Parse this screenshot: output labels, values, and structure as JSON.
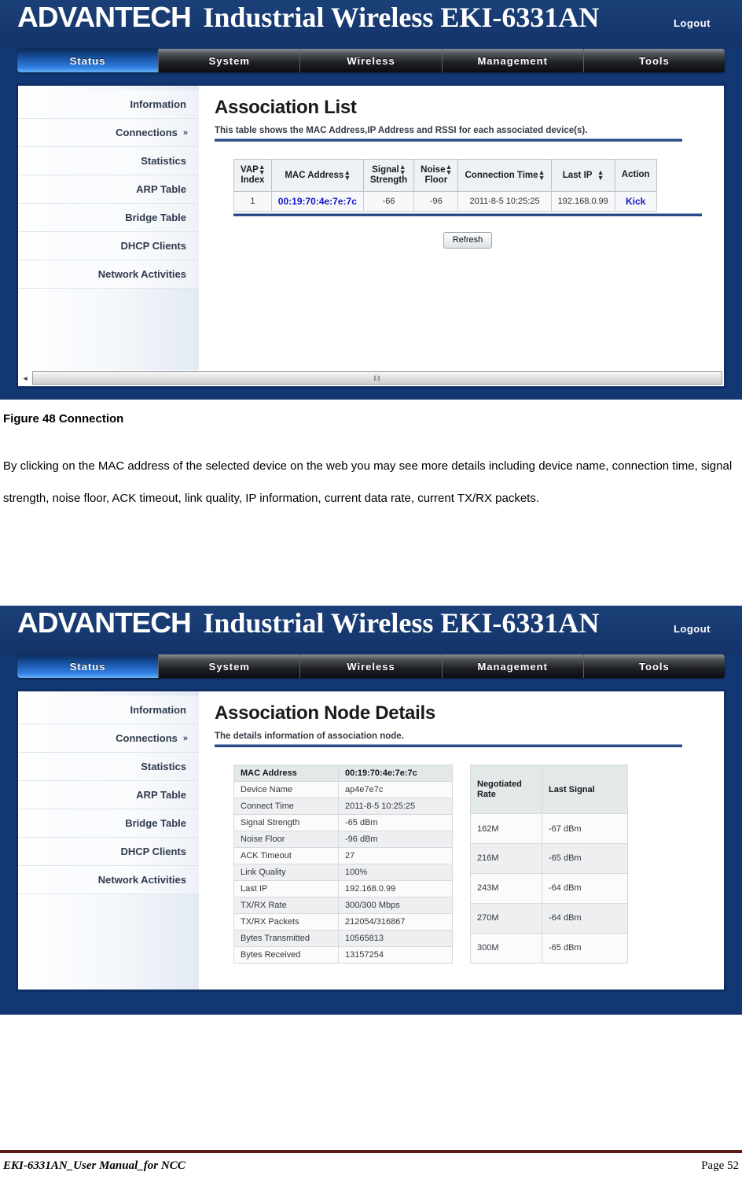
{
  "page": {
    "figure_caption": "Figure 48 Connection",
    "paragraph": "By clicking on the MAC address of the selected device on the web you may see more details including device name, connection time, signal strength, noise floor, ACK timeout, link quality, IP information, current data rate, current TX/RX packets.",
    "footer_left": "EKI-6331AN_User Manual_for NCC",
    "footer_right": "Page 52"
  },
  "colors": {
    "header_blue": "#123772",
    "active_tab_blue": "#2e7ee0",
    "link_blue": "#1414cc",
    "rule_blue": "#2a4d87",
    "footer_rule": "#5b1a17"
  },
  "device_ui": {
    "brand_mark": "ADVANTECH",
    "product_title": "Industrial Wireless EKI-6331AN",
    "logout_label": "Logout",
    "nav_tabs": [
      {
        "label": "Status",
        "active": true
      },
      {
        "label": "System",
        "active": false
      },
      {
        "label": "Wireless",
        "active": false
      },
      {
        "label": "Management",
        "active": false
      },
      {
        "label": "Tools",
        "active": false
      }
    ],
    "sidebar_items": [
      {
        "label": "Information",
        "chevron": ""
      },
      {
        "label": "Connections",
        "chevron": "»"
      },
      {
        "label": "Statistics",
        "chevron": ""
      },
      {
        "label": "ARP Table",
        "chevron": ""
      },
      {
        "label": "Bridge Table",
        "chevron": ""
      },
      {
        "label": "DHCP Clients",
        "chevron": ""
      },
      {
        "label": "Network Activities",
        "chevron": ""
      }
    ]
  },
  "screen1": {
    "title": "Association List",
    "description": "This table shows the MAC Address,IP Address and RSSI for each associated device(s).",
    "table": {
      "headers": [
        "VAP Index",
        "MAC Address",
        "Signal Strength",
        "Noise Floor",
        "Connection Time",
        "Last IP",
        "Action"
      ],
      "header_lines": [
        [
          "VAP",
          "Index"
        ],
        [
          "MAC Address"
        ],
        [
          "Signal",
          "Strength"
        ],
        [
          "Noise",
          "Floor"
        ],
        [
          "Connection Time"
        ],
        [
          "Last IP"
        ],
        [
          "Action"
        ]
      ],
      "sortable": [
        true,
        true,
        true,
        true,
        true,
        true,
        false
      ],
      "rows": [
        {
          "vap_index": "1",
          "mac_address": "00:19:70:4e:7e:7c",
          "signal_strength": "-66",
          "noise_floor": "-96",
          "connection_time": "2011-8-5 10:25:25",
          "last_ip": "192.168.0.99",
          "action": "Kick"
        }
      ]
    },
    "refresh_label": "Refresh",
    "scrollbar": {
      "left_arrow_glyph": "◄",
      "thumb_grip": "‖‖"
    }
  },
  "screen2": {
    "title": "Association Node Details",
    "description": "The details information of association node.",
    "detail_table": [
      {
        "key": "MAC Address",
        "value": "00:19:70:4e:7e:7c",
        "header": true
      },
      {
        "key": "Device Name",
        "value": "ap4e7e7c",
        "header": false
      },
      {
        "key": "Connect Time",
        "value": "2011-8-5 10:25:25",
        "header": false
      },
      {
        "key": "Signal Strength",
        "value": "-65 dBm",
        "header": false
      },
      {
        "key": "Noise Floor",
        "value": "-96 dBm",
        "header": false
      },
      {
        "key": "ACK Timeout",
        "value": "27",
        "header": false
      },
      {
        "key": "Link Quality",
        "value": "100%",
        "header": false
      },
      {
        "key": "Last IP",
        "value": "192.168.0.99",
        "header": false
      },
      {
        "key": "TX/RX Rate",
        "value": "300/300 Mbps",
        "header": false
      },
      {
        "key": "TX/RX Packets",
        "value": "212054/316867",
        "header": false
      },
      {
        "key": "Bytes Transmitted",
        "value": "10565813",
        "header": false
      },
      {
        "key": "Bytes Received",
        "value": "13157254",
        "header": false
      }
    ],
    "rate_table": {
      "headers": [
        "Negotiated Rate",
        "Last Signal"
      ],
      "header_lines": [
        [
          "Negotiated",
          "Rate"
        ],
        [
          "Last Signal"
        ]
      ],
      "rows": [
        {
          "rate": "162M",
          "signal": "-67 dBm"
        },
        {
          "rate": "216M",
          "signal": "-65 dBm"
        },
        {
          "rate": "243M",
          "signal": "-64 dBm"
        },
        {
          "rate": "270M",
          "signal": "-64 dBm"
        },
        {
          "rate": "300M",
          "signal": "-65 dBm"
        }
      ]
    }
  }
}
